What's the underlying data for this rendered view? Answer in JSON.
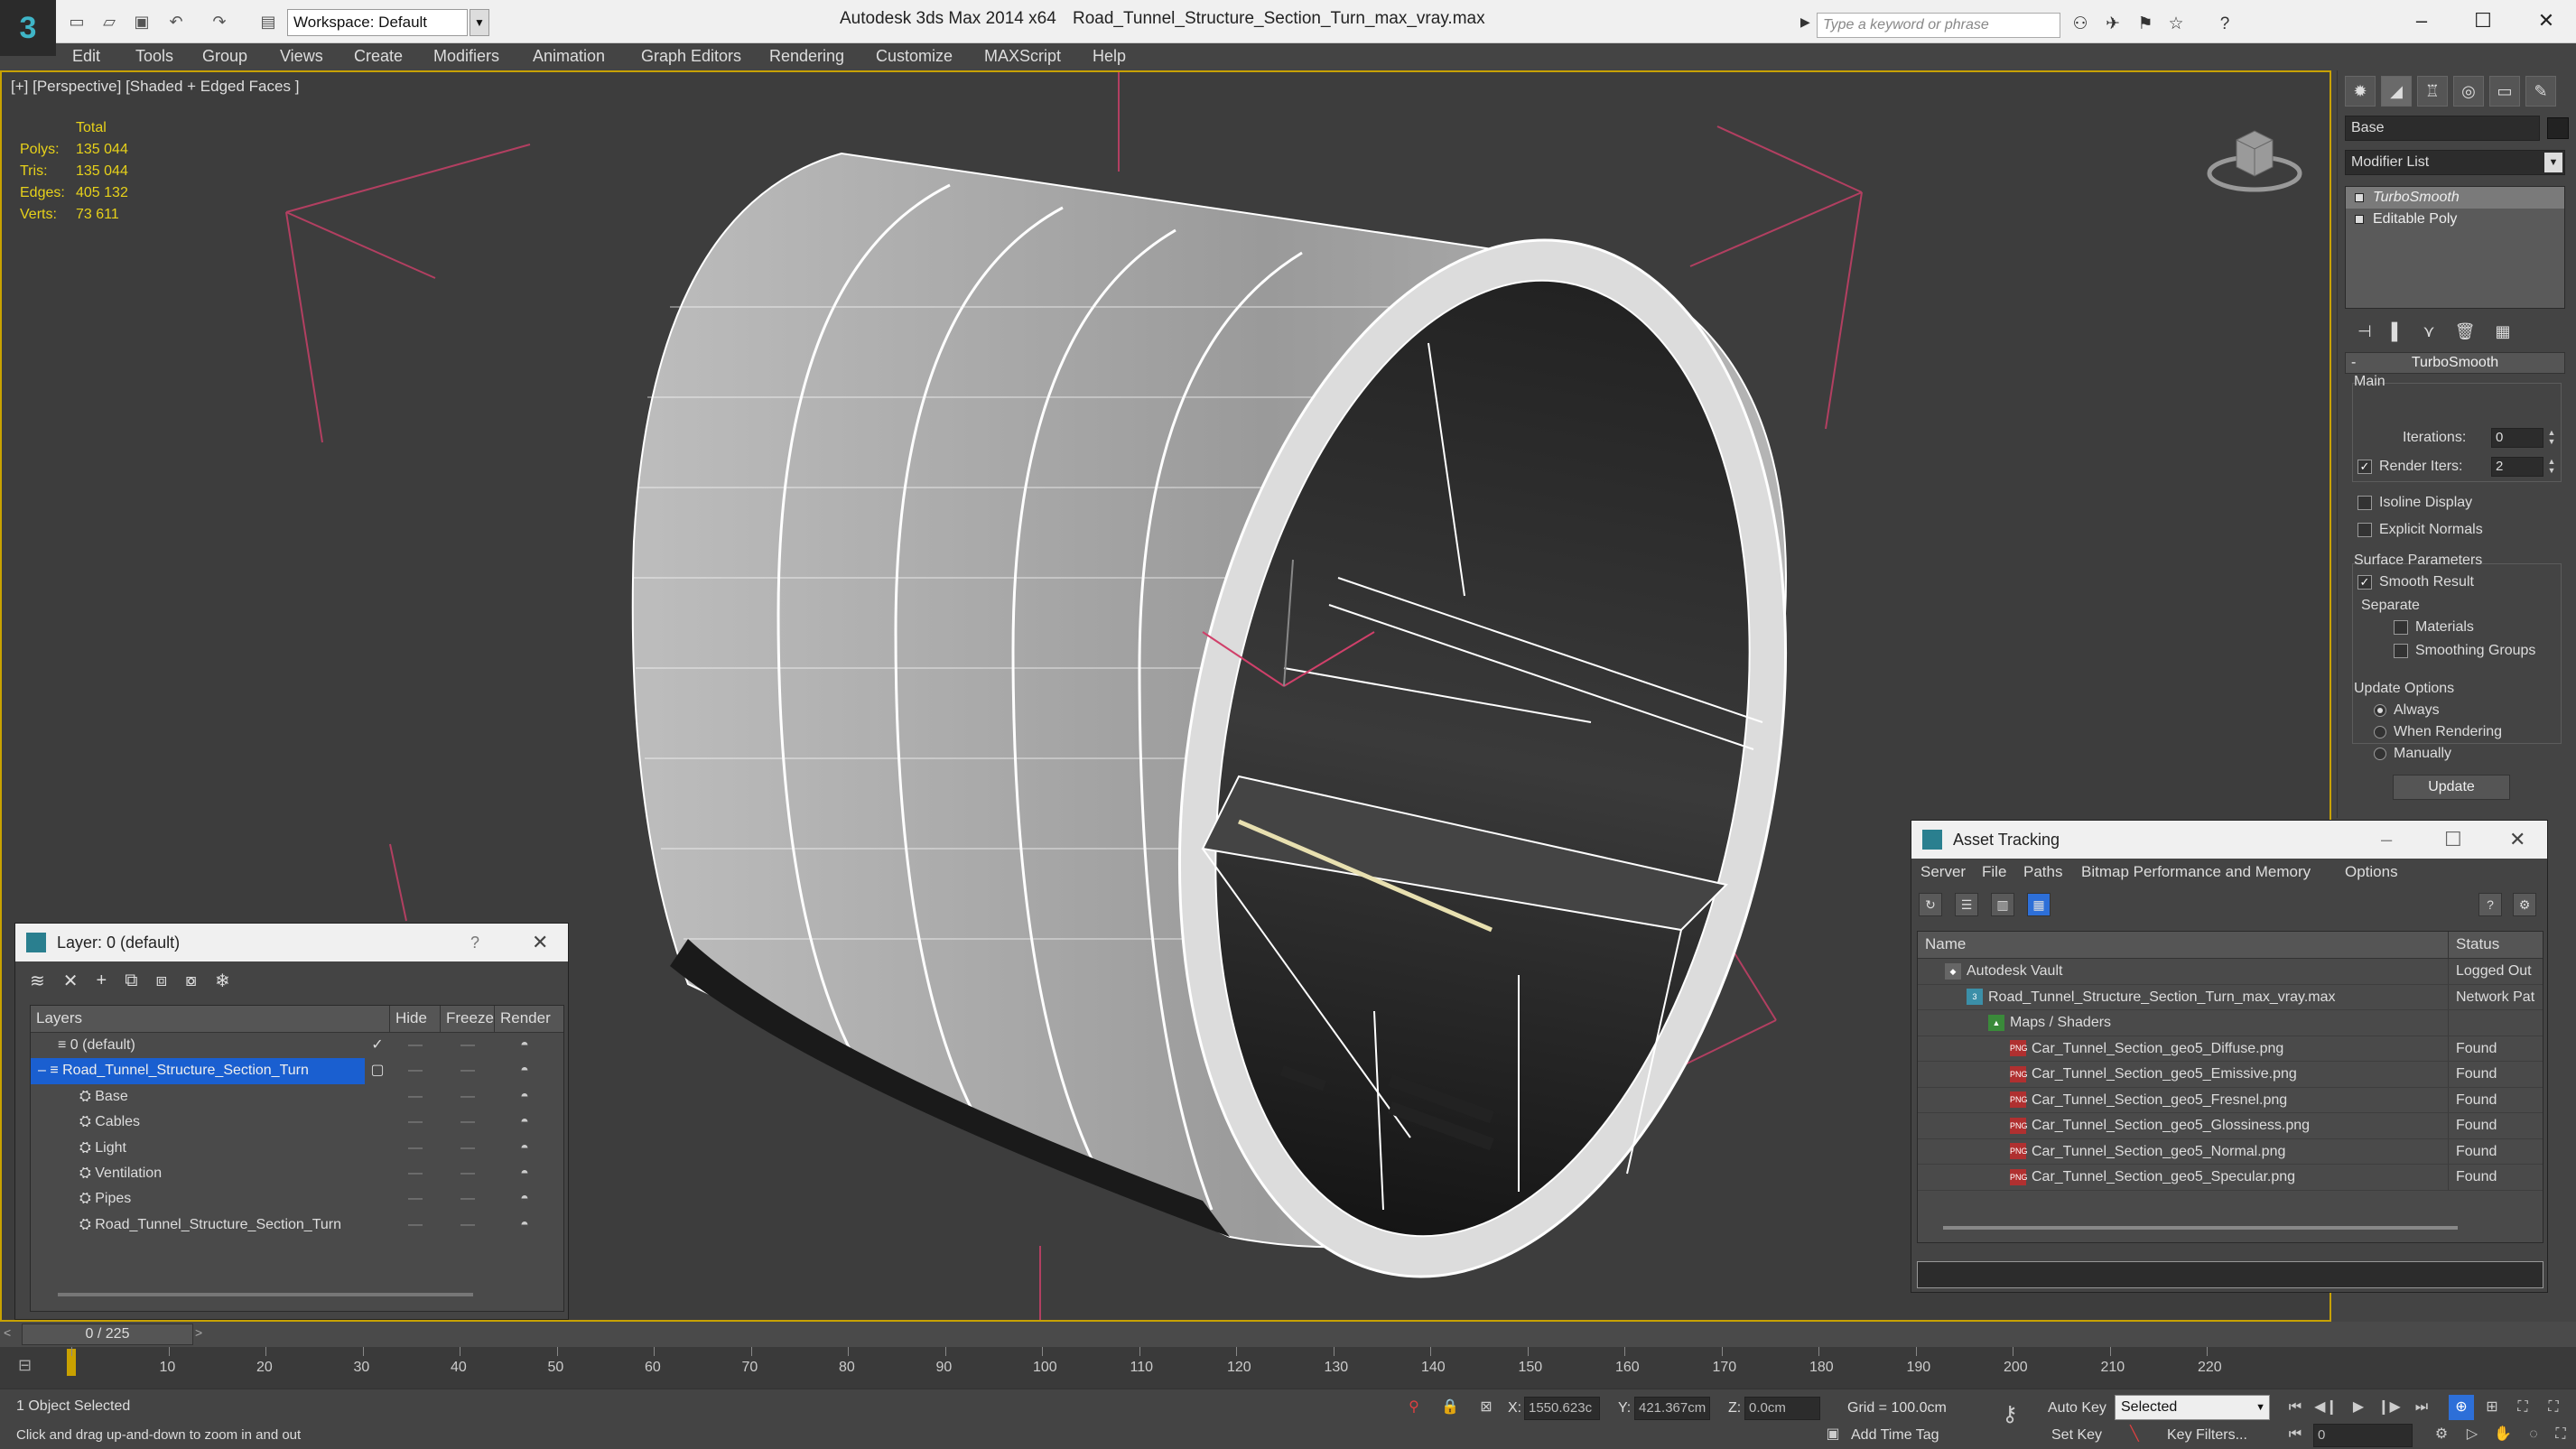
{
  "titlebar": {
    "workspace": "Workspace: Default",
    "app_title": "Autodesk 3ds Max  2014 x64",
    "file_name": "Road_Tunnel_Structure_Section_Turn_max_vray.max",
    "search_placeholder": "Type a keyword or phrase"
  },
  "menu": [
    "Edit",
    "Tools",
    "Group",
    "Views",
    "Create",
    "Modifiers",
    "Animation",
    "Graph Editors",
    "Rendering",
    "Customize",
    "MAXScript",
    "Help"
  ],
  "viewport": {
    "label": "[+] [Perspective] [Shaded + Edged Faces ]",
    "stats": {
      "total_label": "Total",
      "rows": [
        {
          "key": "Polys:",
          "value": "135 044"
        },
        {
          "key": "Tris:",
          "value": "135 044"
        },
        {
          "key": "Edges:",
          "value": "405 132"
        },
        {
          "key": "Verts:",
          "value": "73 611"
        }
      ]
    }
  },
  "command_panel": {
    "object_name": "Base",
    "modifier_list": "Modifier List",
    "stack": [
      "TurboSmooth",
      "Editable Poly"
    ],
    "rollout_title": "TurboSmooth",
    "main_label": "Main",
    "iterations_label": "Iterations:",
    "iterations_value": "0",
    "render_iters_label": "Render Iters:",
    "render_iters_value": "2",
    "isoline_label": "Isoline Display",
    "explicit_normals_label": "Explicit Normals",
    "surface_params_label": "Surface Parameters",
    "smooth_result_label": "Smooth Result",
    "separate_label": "Separate",
    "materials_label": "Materials",
    "smoothing_groups_label": "Smoothing Groups",
    "update_options_label": "Update Options",
    "always_label": "Always",
    "when_rendering_label": "When Rendering",
    "manually_label": "Manually",
    "update_button": "Update"
  },
  "layer_dialog": {
    "title": "Layer: 0 (default)",
    "help": "?",
    "columns": [
      "Layers",
      "Hide",
      "Freeze",
      "Render"
    ],
    "rows": [
      {
        "name": "0 (default)",
        "indent": 0,
        "current": "✓"
      },
      {
        "name": "Road_Tunnel_Structure_Section_Turn",
        "indent": 0,
        "current": "▢",
        "selected": true
      },
      {
        "name": "Base",
        "indent": 1
      },
      {
        "name": "Cables",
        "indent": 1
      },
      {
        "name": "Light",
        "indent": 1
      },
      {
        "name": "Ventilation",
        "indent": 1
      },
      {
        "name": "Pipes",
        "indent": 1
      },
      {
        "name": "Road_Tunnel_Structure_Section_Turn",
        "indent": 1
      }
    ]
  },
  "asset_tracking": {
    "title": "Asset Tracking",
    "menu": [
      "Server",
      "File",
      "Paths",
      "Bitmap Performance and Memory",
      "Options"
    ],
    "columns": [
      "Name",
      "Status"
    ],
    "rows": [
      {
        "name": "Autodesk Vault",
        "status": "Logged Out",
        "indent": 1,
        "icon": "vault"
      },
      {
        "name": "Road_Tunnel_Structure_Section_Turn_max_vray.max",
        "status": "Network Pat",
        "indent": 2,
        "icon": "max"
      },
      {
        "name": "Maps / Shaders",
        "status": "",
        "indent": 3,
        "icon": "maps"
      },
      {
        "name": "Car_Tunnel_Section_geo5_Diffuse.png",
        "status": "Found",
        "indent": 4,
        "icon": "png"
      },
      {
        "name": "Car_Tunnel_Section_geo5_Emissive.png",
        "status": "Found",
        "indent": 4,
        "icon": "png"
      },
      {
        "name": "Car_Tunnel_Section_geo5_Fresnel.png",
        "status": "Found",
        "indent": 4,
        "icon": "png"
      },
      {
        "name": "Car_Tunnel_Section_geo5_Glossiness.png",
        "status": "Found",
        "indent": 4,
        "icon": "png"
      },
      {
        "name": "Car_Tunnel_Section_geo5_Normal.png",
        "status": "Found",
        "indent": 4,
        "icon": "png"
      },
      {
        "name": "Car_Tunnel_Section_geo5_Specular.png",
        "status": "Found",
        "indent": 4,
        "icon": "png"
      }
    ]
  },
  "timeline": {
    "slider_label": "0 / 225",
    "ticks": [
      "0",
      "10",
      "20",
      "30",
      "40",
      "50",
      "60",
      "70",
      "80",
      "90",
      "100",
      "110",
      "120",
      "130",
      "140",
      "150",
      "160",
      "170",
      "180",
      "190",
      "200",
      "210",
      "220"
    ]
  },
  "status": {
    "selection": "1 Object Selected",
    "prompt": "Click and drag up-and-down to zoom in and out",
    "x_label": "X:",
    "x_value": "1550.623c",
    "y_label": "Y:",
    "y_value": "421.367cm",
    "z_label": "Z:",
    "z_value": "0.0cm",
    "grid": "Grid = 100.0cm",
    "auto_key": "Auto Key",
    "set_key": "Set Key",
    "selected_option": "Selected",
    "key_filters": "Key Filters...",
    "add_time_tag": "Add Time Tag",
    "frame_value": "0"
  },
  "colors": {
    "accent": "#2d6fd8",
    "viewport_border": "#c8a200",
    "stats": "#e7d11a"
  }
}
